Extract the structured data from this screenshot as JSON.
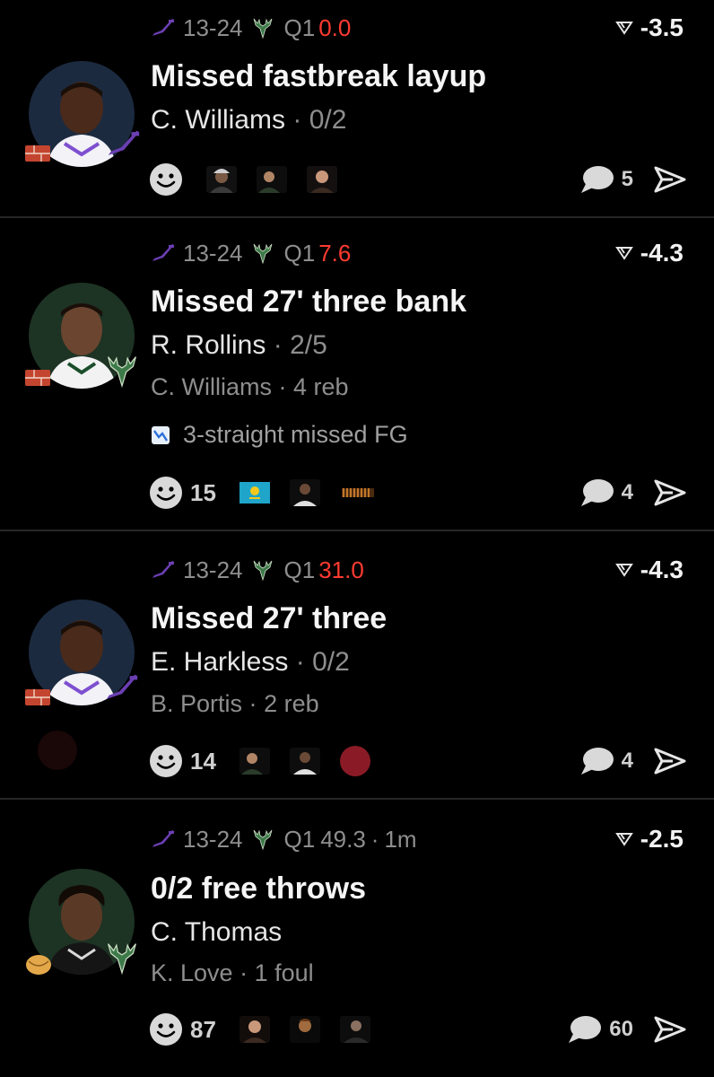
{
  "icons": {
    "jazz_logo": "jazz-note-icon",
    "bucks_logo": "deer-icon",
    "odds_arrow": "spread-arrow-icon",
    "brick": "brick-icon",
    "smile": "smile-icon",
    "comment": "comment-bubble-icon",
    "send": "send-arrow-icon"
  },
  "colors": {
    "clock_red": "#ff3b30",
    "background": "#000000",
    "muted": "#8e8e8e",
    "jazz_purple": "#6b3fb3",
    "bucks_green": "#1b4d2b"
  },
  "plays": [
    {
      "score": "13-24",
      "quarter": "Q1",
      "clock": "0.0",
      "odds": "-3.5",
      "title": "Missed fastbreak layup",
      "player": "C. Williams",
      "player_stat": "0/2",
      "comments": "5",
      "reactions": {
        "count": ""
      }
    },
    {
      "score": "13-24",
      "quarter": "Q1",
      "clock": "7.6",
      "odds": "-4.3",
      "title": "Missed 27' three bank",
      "player": "R. Rollins",
      "player_stat": "2/5",
      "secondary": "C. Williams",
      "secondary_stat": "4 reb",
      "streak": "3-straight missed FG",
      "comments": "4",
      "reactions": {
        "count": "15"
      }
    },
    {
      "score": "13-24",
      "quarter": "Q1",
      "clock": "31.0",
      "odds": "-4.3",
      "title": "Missed 27' three",
      "player": "E. Harkless",
      "player_stat": "0/2",
      "secondary": "B. Portis",
      "secondary_stat": "2 reb",
      "comments": "4",
      "reactions": {
        "count": "14"
      }
    },
    {
      "score": "13-24",
      "quarter": "Q1",
      "clock": "49.3",
      "time_ago": "1m",
      "odds": "-2.5",
      "title": "0/2 free throws",
      "player": "C. Thomas",
      "secondary": "K. Love",
      "secondary_stat": "1 foul",
      "comments": "60",
      "reactions": {
        "count": "87"
      }
    }
  ],
  "separator": "·"
}
